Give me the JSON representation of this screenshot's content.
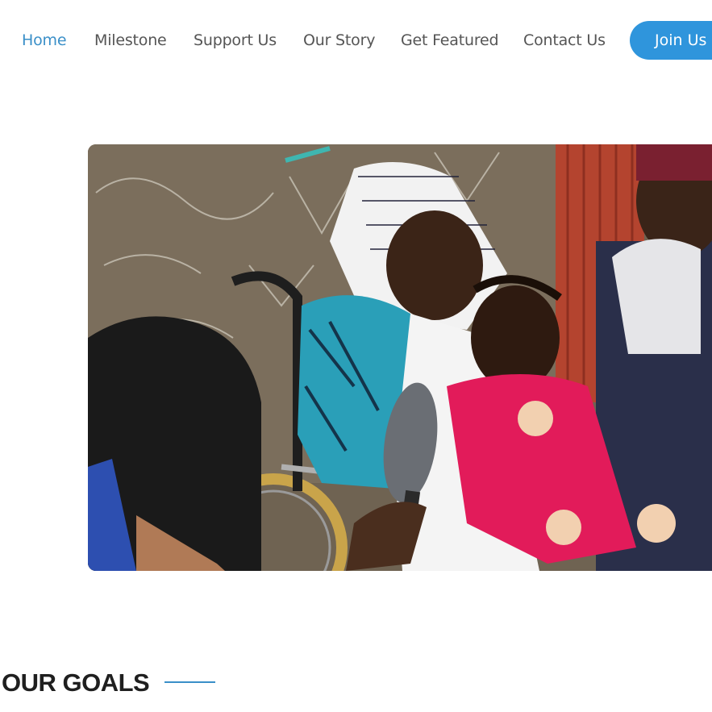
{
  "nav": {
    "items": [
      {
        "label": "Home",
        "active": true
      },
      {
        "label": "Milestone",
        "active": false
      },
      {
        "label": "Support Us",
        "active": false
      },
      {
        "label": "Our Story",
        "active": false
      },
      {
        "label": "Get Featured",
        "active": false
      },
      {
        "label": "Contact Us",
        "active": false
      }
    ],
    "cta_label": "Join Us"
  },
  "hero": {
    "image_subject": "woman in wheelchair holding a child in pink dress, being interviewed with a microphone"
  },
  "goals": {
    "heading": "OUR GOALS"
  },
  "colors": {
    "accent": "#3a8fc8",
    "button": "#2f95dc",
    "nav_text": "#555555",
    "heading": "#1f1f1f"
  }
}
